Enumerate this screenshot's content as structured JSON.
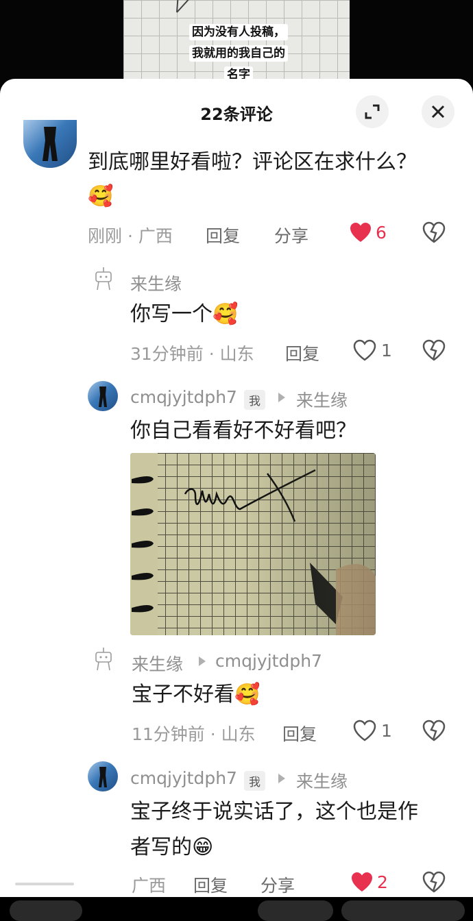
{
  "video": {
    "caption_lines": [
      "因为没有人投稿，",
      "我就用的我自己的",
      "名字"
    ]
  },
  "header": {
    "title": "22条评论",
    "expand_icon": "expand-icon",
    "close_icon": "close-icon"
  },
  "comments": [
    {
      "text_line1": "到底哪里好看啦？评论区在求什么？",
      "text_line2": "🥰",
      "time": "刚刚",
      "location": "广西",
      "reply_label": "回复",
      "share_label": "分享",
      "likes": "6",
      "liked": true
    },
    {
      "username": "来生缘",
      "text": "你写一个🥰",
      "time": "31分钟前",
      "location": "山东",
      "reply_label": "回复",
      "likes": "1"
    },
    {
      "username": "cmqjyjtdph7",
      "me_tag": "我",
      "reply_to": "来生缘",
      "text": "你自己看看好不好看吧？"
    },
    {
      "username": "来生缘",
      "reply_to": "cmqjyjtdph7",
      "text": "宝子不好看🥰",
      "time": "11分钟前",
      "location": "山东",
      "reply_label": "回复",
      "likes": "1"
    },
    {
      "username": "cmqjyjtdph7",
      "me_tag": "我",
      "reply_to": "来生缘",
      "text_line1": "宝子终于说实话了，这个也是作",
      "text_line2": "者写的😁",
      "location": "广西",
      "reply_label": "回复",
      "share_label": "分享",
      "likes": "2",
      "liked": true
    }
  ],
  "colors": {
    "liked": "#e8314f",
    "muted": "#9a9a9a",
    "text": "#1b1b1b"
  }
}
